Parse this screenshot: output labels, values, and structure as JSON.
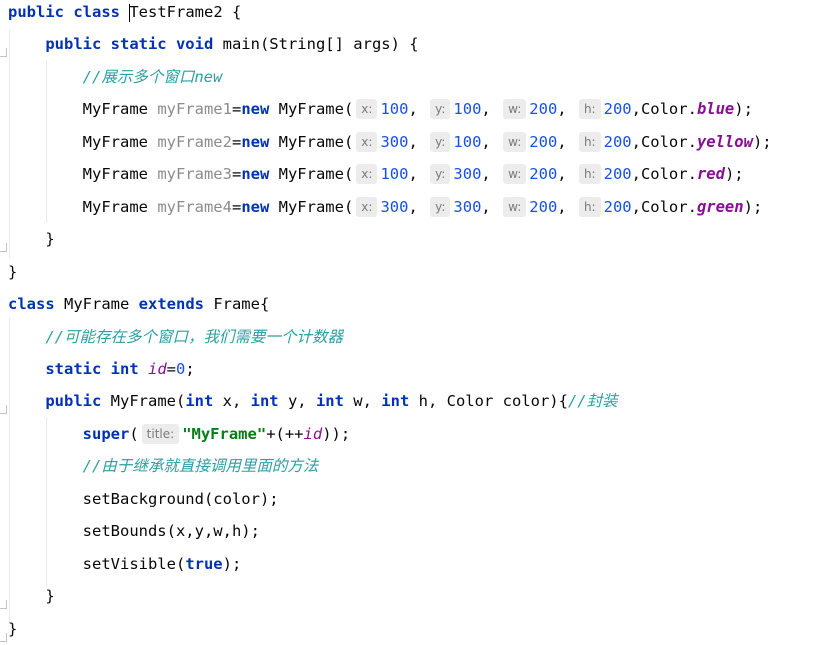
{
  "editor": {
    "language": "java",
    "lines": [
      [
        {
          "t": "public class ",
          "c": "kw"
        },
        {
          "t": "",
          "cursor": true
        },
        {
          "t": "TestFrame2 {"
        }
      ],
      [
        {
          "t": "    "
        },
        {
          "t": "public static void ",
          "c": "kw"
        },
        {
          "t": "main(String[] args) {"
        }
      ],
      [
        {
          "t": "        "
        },
        {
          "t": "//展示多个窗口new",
          "c": "cmt"
        }
      ],
      [
        {
          "t": "        MyFrame "
        },
        {
          "t": "myFrame1",
          "c": "unused"
        },
        {
          "t": "="
        },
        {
          "t": "new ",
          "c": "kw"
        },
        {
          "t": "MyFrame("
        },
        {
          "h": "x:"
        },
        {
          "t": "100",
          "c": "num"
        },
        {
          "t": ", "
        },
        {
          "h": "y:"
        },
        {
          "t": "100",
          "c": "num"
        },
        {
          "t": ", "
        },
        {
          "h": "w:"
        },
        {
          "t": "200",
          "c": "num"
        },
        {
          "t": ", "
        },
        {
          "h": "h:"
        },
        {
          "t": "200",
          "c": "num"
        },
        {
          "t": ",Color."
        },
        {
          "t": "blue",
          "c": "sfld"
        },
        {
          "t": ");"
        }
      ],
      [
        {
          "t": "        MyFrame "
        },
        {
          "t": "myFrame2",
          "c": "unused"
        },
        {
          "t": "="
        },
        {
          "t": "new ",
          "c": "kw"
        },
        {
          "t": "MyFrame("
        },
        {
          "h": "x:"
        },
        {
          "t": "300",
          "c": "num"
        },
        {
          "t": ", "
        },
        {
          "h": "y:"
        },
        {
          "t": "100",
          "c": "num"
        },
        {
          "t": ", "
        },
        {
          "h": "w:"
        },
        {
          "t": "200",
          "c": "num"
        },
        {
          "t": ", "
        },
        {
          "h": "h:"
        },
        {
          "t": "200",
          "c": "num"
        },
        {
          "t": ",Color."
        },
        {
          "t": "yellow",
          "c": "sfld"
        },
        {
          "t": ");"
        }
      ],
      [
        {
          "t": "        MyFrame "
        },
        {
          "t": "myFrame3",
          "c": "unused"
        },
        {
          "t": "="
        },
        {
          "t": "new ",
          "c": "kw"
        },
        {
          "t": "MyFrame("
        },
        {
          "h": "x:"
        },
        {
          "t": "100",
          "c": "num"
        },
        {
          "t": ", "
        },
        {
          "h": "y:"
        },
        {
          "t": "300",
          "c": "num"
        },
        {
          "t": ", "
        },
        {
          "h": "w:"
        },
        {
          "t": "200",
          "c": "num"
        },
        {
          "t": ", "
        },
        {
          "h": "h:"
        },
        {
          "t": "200",
          "c": "num"
        },
        {
          "t": ",Color."
        },
        {
          "t": "red",
          "c": "sfld"
        },
        {
          "t": ");"
        }
      ],
      [
        {
          "t": "        MyFrame "
        },
        {
          "t": "myFrame4",
          "c": "unused"
        },
        {
          "t": "="
        },
        {
          "t": "new ",
          "c": "kw"
        },
        {
          "t": "MyFrame("
        },
        {
          "h": "x:"
        },
        {
          "t": "300",
          "c": "num"
        },
        {
          "t": ", "
        },
        {
          "h": "y:"
        },
        {
          "t": "300",
          "c": "num"
        },
        {
          "t": ", "
        },
        {
          "h": "w:"
        },
        {
          "t": "200",
          "c": "num"
        },
        {
          "t": ", "
        },
        {
          "h": "h:"
        },
        {
          "t": "200",
          "c": "num"
        },
        {
          "t": ",Color."
        },
        {
          "t": "green",
          "c": "sfld"
        },
        {
          "t": ");"
        }
      ],
      [
        {
          "t": "    }"
        }
      ],
      [
        {
          "t": "}"
        }
      ],
      [
        {
          "t": "class ",
          "c": "kw"
        },
        {
          "t": "MyFrame "
        },
        {
          "t": "extends ",
          "c": "kw"
        },
        {
          "t": "Frame{"
        }
      ],
      [
        {
          "t": "    "
        },
        {
          "t": "//可能存在多个窗口，我们需要一个计数器",
          "c": "cmt"
        }
      ],
      [
        {
          "t": "    "
        },
        {
          "t": "static int ",
          "c": "kw"
        },
        {
          "t": "id",
          "c": "fld"
        },
        {
          "t": "="
        },
        {
          "t": "0",
          "c": "num"
        },
        {
          "t": ";"
        }
      ],
      [
        {
          "t": "    "
        },
        {
          "t": "public ",
          "c": "kw"
        },
        {
          "t": "MyFrame("
        },
        {
          "t": "int ",
          "c": "kw"
        },
        {
          "t": "x, "
        },
        {
          "t": "int ",
          "c": "kw"
        },
        {
          "t": "y, "
        },
        {
          "t": "int ",
          "c": "kw"
        },
        {
          "t": "w, "
        },
        {
          "t": "int ",
          "c": "kw"
        },
        {
          "t": "h, Color color){"
        },
        {
          "t": "//封装",
          "c": "cmt"
        }
      ],
      [
        {
          "t": "        "
        },
        {
          "t": "super",
          "c": "kw"
        },
        {
          "t": "("
        },
        {
          "h": "title:"
        },
        {
          "t": "\"MyFrame\"",
          "c": "str"
        },
        {
          "t": "+(++"
        },
        {
          "t": "id",
          "c": "fld"
        },
        {
          "t": "));"
        }
      ],
      [
        {
          "t": "        "
        },
        {
          "t": "//由于继承就直接调用里面的方法",
          "c": "cmt"
        }
      ],
      [
        {
          "t": "        setBackground(color);"
        }
      ],
      [
        {
          "t": "        setBounds(x,y,w,h);"
        }
      ],
      [
        {
          "t": "        setVisible("
        },
        {
          "t": "true",
          "c": "kw"
        },
        {
          "t": ");"
        }
      ],
      [
        {
          "t": "    }"
        }
      ],
      [
        {
          "t": "}"
        }
      ]
    ]
  }
}
